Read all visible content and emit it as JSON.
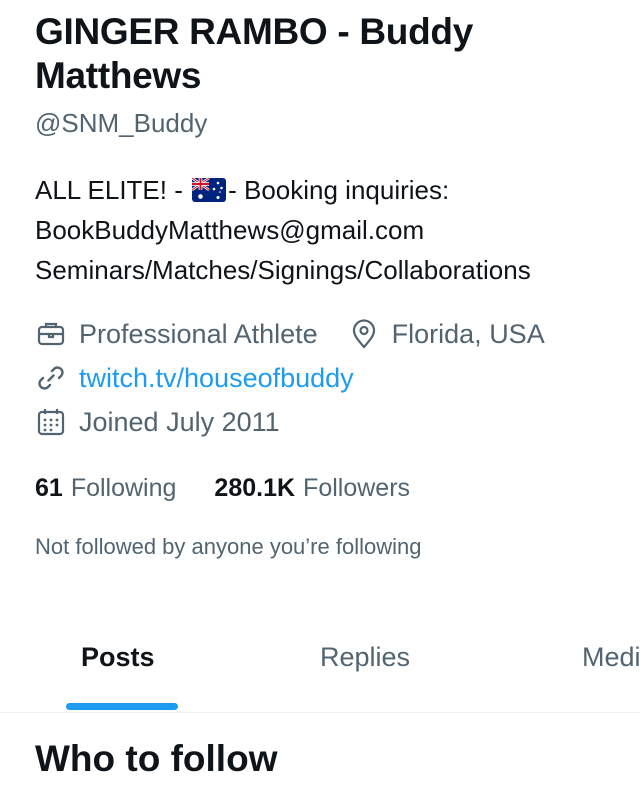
{
  "profile": {
    "display_name": "GINGER RAMBO - Buddy Matthews",
    "handle": "@SNM_Buddy",
    "bio_part1": "ALL ELITE! - ",
    "bio_flag_icon": "australia-flag-icon",
    "bio_part2": "- Booking inquiries:",
    "bio_line2": "BookBuddyMatthews@gmail.com",
    "bio_line3": "Seminars/Matches/Signings/Collaborations",
    "category": "Professional Athlete",
    "location": "Florida, USA",
    "website": "twitch.tv/houseofbuddy",
    "joined": "Joined July 2011"
  },
  "stats": {
    "following_count": "61",
    "following_label": "Following",
    "followers_count": "280.1K",
    "followers_label": "Followers"
  },
  "followed_by_note": "Not followed by anyone you’re following",
  "tabs": [
    {
      "label": "Posts",
      "active": true
    },
    {
      "label": "Replies",
      "active": false
    },
    {
      "label": "Media",
      "active": false
    }
  ],
  "sections": {
    "who_to_follow": "Who to follow"
  },
  "colors": {
    "accent": "#1d9bf0",
    "text_primary": "#0f1419",
    "text_secondary": "#536471"
  }
}
